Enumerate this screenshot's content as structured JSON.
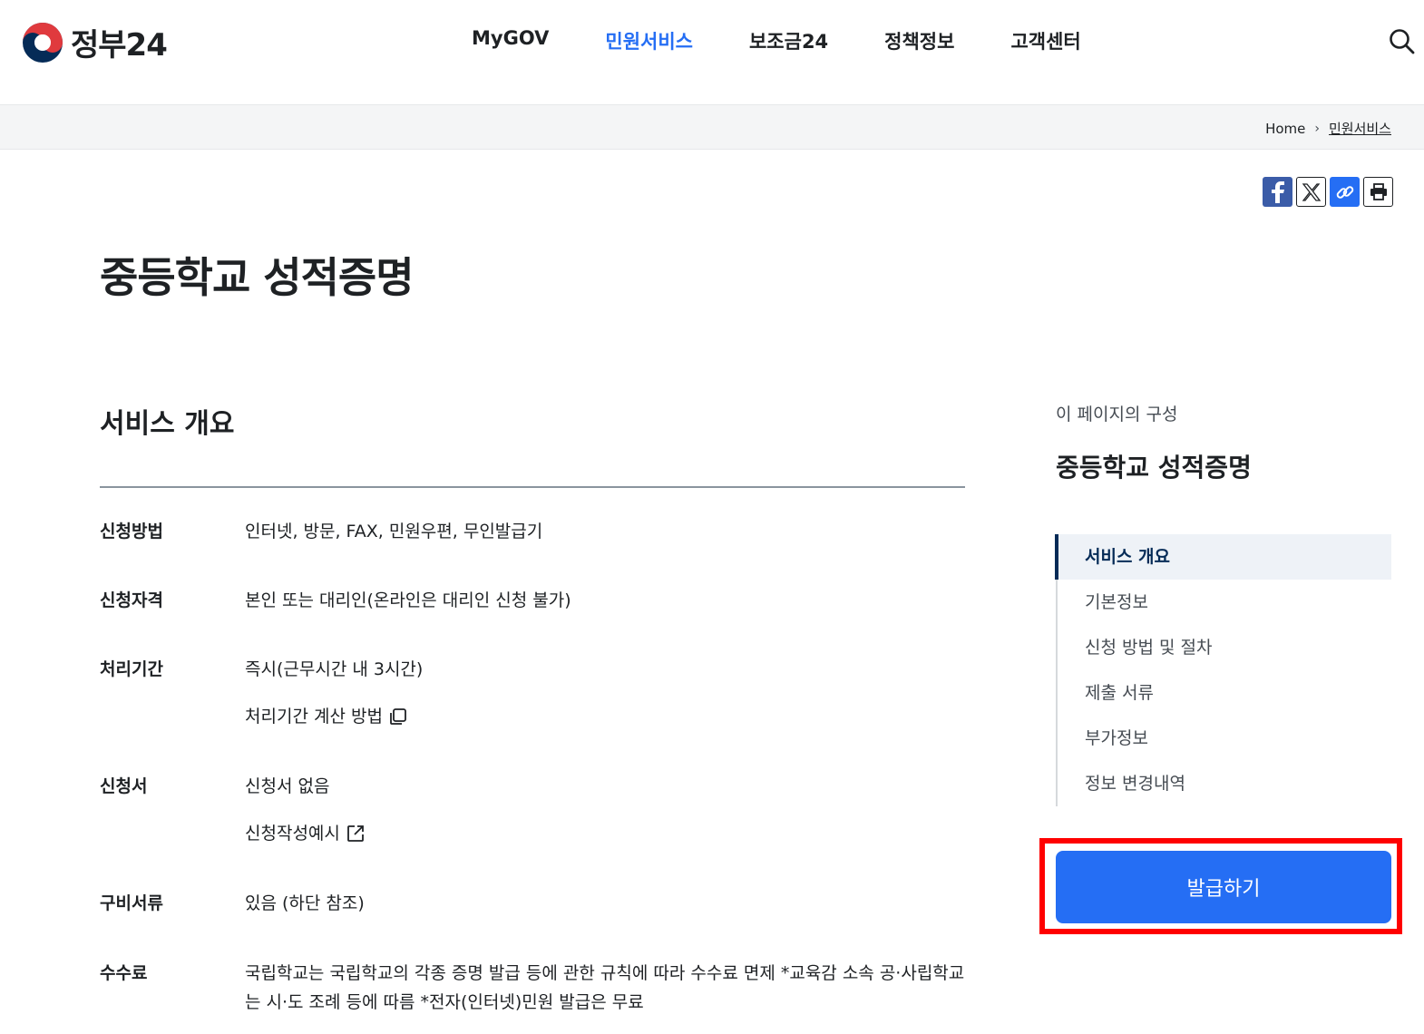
{
  "header": {
    "logo_text": "정부24",
    "nav": [
      {
        "label": "MyGOV"
      },
      {
        "label": "민원서비스"
      },
      {
        "label": "보조금24"
      },
      {
        "label": "정책정보"
      },
      {
        "label": "고객센터"
      }
    ]
  },
  "breadcrumb": {
    "home": "Home",
    "current": "민원서비스"
  },
  "page": {
    "title": "중등학교 성적증명"
  },
  "overview": {
    "heading": "서비스 개요",
    "rows": [
      {
        "key": "신청방법",
        "value": "인터넷, 방문, FAX, 민원우편, 무인발급기"
      },
      {
        "key": "신청자격",
        "value": "본인 또는 대리인(온라인은 대리인 신청 불가)"
      },
      {
        "key": "처리기간",
        "value": "즉시(근무시간 내 3시간)",
        "link": "처리기간 계산 방법"
      },
      {
        "key": "신청서",
        "value": "신청서 없음",
        "link": "신청작성예시"
      },
      {
        "key": "구비서류",
        "value": "있음 (하단 참조)"
      },
      {
        "key": "수수료",
        "value": "국립학교는 국립학교의 각종 증명 발급 등에 관한 규칙에 따라 수수료 면제 *교육감 소속 공·사립학교는 시·도 조례 등에 따름 *전자(인터넷)민원 발급은 무료"
      }
    ]
  },
  "toc": {
    "caption": "이 페이지의 구성",
    "title": "중등학교 성적증명",
    "items": [
      {
        "label": "서비스 개요"
      },
      {
        "label": "기본정보"
      },
      {
        "label": "신청 방법 및 절차"
      },
      {
        "label": "제출 서류"
      },
      {
        "label": "부가정보"
      },
      {
        "label": "정보 변경내역"
      }
    ]
  },
  "actions": {
    "issue_label": "발급하기"
  },
  "colors": {
    "primary": "#256ef4",
    "navy": "#052b57",
    "highlight_border": "#ff0000"
  }
}
